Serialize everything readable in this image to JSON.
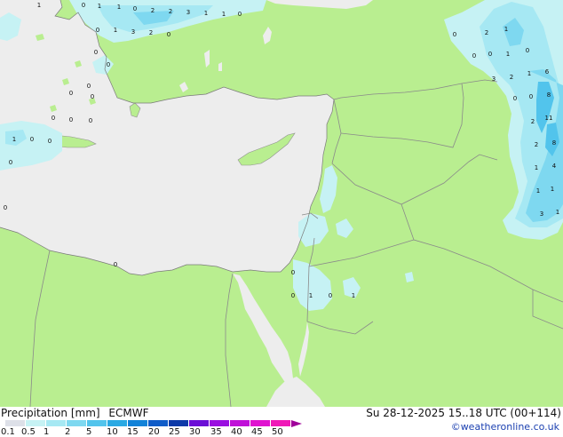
{
  "footer": {
    "title": "Precipitation [mm]",
    "model": "ECMWF",
    "datetime": "Su 28-12-2025 15..18 UTC (00+114)",
    "credit": "©weatheronline.co.uk"
  },
  "legend": {
    "ticks": [
      "0.1",
      "0.5",
      "1",
      "2",
      "5",
      "10",
      "15",
      "20",
      "25",
      "30",
      "35",
      "40",
      "45",
      "50"
    ],
    "colors": [
      "#dde0e8",
      "#c6f2f4",
      "#a6e8f3",
      "#7ed8f0",
      "#52c4ec",
      "#2aa9e3",
      "#1282d8",
      "#0f5cc8",
      "#0d3aa8",
      "#6b0ed6",
      "#9a0fe0",
      "#c010d8",
      "#e012d0",
      "#f019b8"
    ]
  },
  "map": {
    "sea_color": "#ededed",
    "land_color": "#b9ee90",
    "border_color": "#909090",
    "values": [
      {
        "text": "1"
      },
      {
        "text": "0"
      },
      {
        "text": "1"
      },
      {
        "text": "1"
      },
      {
        "text": "0"
      },
      {
        "text": "2"
      },
      {
        "text": "2"
      },
      {
        "text": "3"
      },
      {
        "text": "1"
      },
      {
        "text": "1"
      },
      {
        "text": "0"
      },
      {
        "text": "0"
      },
      {
        "text": "1"
      },
      {
        "text": "3"
      },
      {
        "text": "2"
      },
      {
        "text": "0"
      },
      {
        "text": "0"
      },
      {
        "text": "0"
      },
      {
        "text": "0"
      },
      {
        "text": "0"
      },
      {
        "text": "0"
      },
      {
        "text": "0"
      },
      {
        "text": "0"
      },
      {
        "text": "0"
      },
      {
        "text": "1"
      },
      {
        "text": "0"
      },
      {
        "text": "0"
      },
      {
        "text": "0"
      },
      {
        "text": "0"
      },
      {
        "text": "0"
      },
      {
        "text": "0"
      },
      {
        "text": "0"
      },
      {
        "text": "1"
      },
      {
        "text": "0"
      },
      {
        "text": "1"
      },
      {
        "text": "0"
      },
      {
        "text": "2"
      },
      {
        "text": "1"
      },
      {
        "text": "0"
      },
      {
        "text": "0"
      },
      {
        "text": "1"
      },
      {
        "text": "0"
      },
      {
        "text": "3"
      },
      {
        "text": "2"
      },
      {
        "text": "1"
      },
      {
        "text": "6"
      },
      {
        "text": "0"
      },
      {
        "text": "0"
      },
      {
        "text": "8"
      },
      {
        "text": "2"
      },
      {
        "text": "11"
      },
      {
        "text": "2"
      },
      {
        "text": "8"
      },
      {
        "text": "1"
      },
      {
        "text": "4"
      },
      {
        "text": "1"
      },
      {
        "text": "1"
      },
      {
        "text": "3"
      },
      {
        "text": "1"
      }
    ]
  }
}
